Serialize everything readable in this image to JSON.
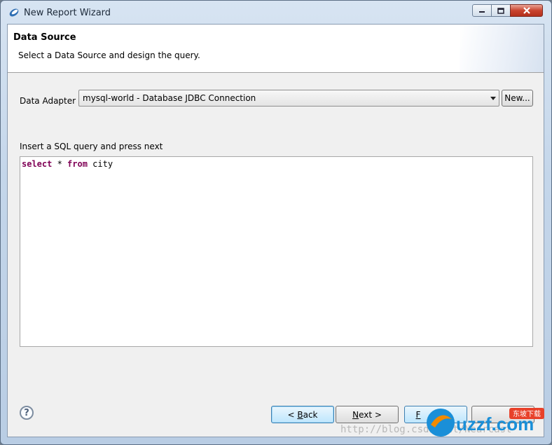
{
  "window": {
    "title": "New Report Wizard",
    "controls": {
      "minimize": "minimize",
      "maximize": "maximize",
      "close": "close"
    }
  },
  "header": {
    "title": "Data Source",
    "subtitle": "Select a Data Source and design the query."
  },
  "adapter": {
    "label": "Data Adapter",
    "selected": "mysql-world - Database JDBC Connection",
    "new_button": "New..."
  },
  "query": {
    "label": "Insert a SQL query and press next",
    "keyword_select": "select",
    "star": " * ",
    "keyword_from": "from",
    "table": " city"
  },
  "footer": {
    "help": "?",
    "back_prefix": "< ",
    "back_key": "B",
    "back_rest": "ack",
    "next_key": "N",
    "next_rest": "ext >",
    "finish_prefix": "F"
  },
  "watermark": {
    "brand": "uzzf.com",
    "badge": "东坡下载",
    "url": "http://blog.csdn.net/Nearcast"
  },
  "colors": {
    "sql_keyword": "#7f0055",
    "focus_border": "#3c7fb1",
    "brand_orange": "#f08a00",
    "brand_blue": "#1a8fd8"
  }
}
